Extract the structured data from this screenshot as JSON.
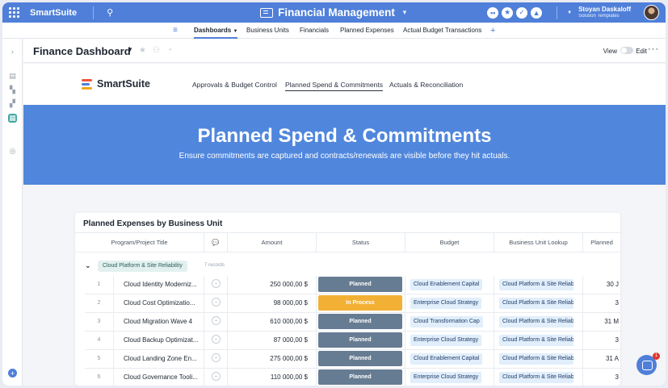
{
  "app": {
    "brand": "SmartSuite",
    "workspace_title": "Financial Management",
    "user_name": "Stoyan Daskaloff",
    "user_subtitle": "Solution Templates"
  },
  "nav_tabs": [
    {
      "label": "Dashboards",
      "active": true
    },
    {
      "label": "Business Units",
      "active": false
    },
    {
      "label": "Financials",
      "active": false
    },
    {
      "label": "Planned Expenses",
      "active": false
    },
    {
      "label": "Actual Budget Transactions",
      "active": false
    }
  ],
  "dashboard": {
    "title": "Finance Dashboard",
    "view_label": "View",
    "edit_label": "Edit"
  },
  "subnav": {
    "logo_text": "SmartSuite",
    "tabs": [
      {
        "label": "Approvals & Budget Control",
        "active": false
      },
      {
        "label": "Planned Spend & Commitments",
        "active": true
      },
      {
        "label": "Actuals & Reconciliation",
        "active": false
      }
    ]
  },
  "hero": {
    "title": "Planned Spend & Commitments",
    "subtitle": "Ensure commitments are captured and contracts/renewals are visible before they hit actuals."
  },
  "table": {
    "title": "Planned Expenses by Business Unit",
    "columns": [
      "Program/Project Title",
      "",
      "Amount",
      "Status",
      "Budget",
      "Business Unit Lookup",
      "Planned"
    ],
    "group": {
      "label": "Cloud Platform & Site Reliability",
      "count": "7 records"
    },
    "rows": [
      {
        "num": "1",
        "title": "Cloud Identity Moderniz...",
        "amount": "250 000,00 $",
        "status": "Planned",
        "budget": "Cloud Enablement Capital",
        "bu": "Cloud Platform & Site Reliabi",
        "planned": "30 J"
      },
      {
        "num": "2",
        "title": "Cloud Cost Optimizatio...",
        "amount": "98 000,00 $",
        "status": "In Process",
        "budget": "Enterprise Cloud Strategy",
        "bu": "Cloud Platform & Site Reliabi",
        "planned": "3"
      },
      {
        "num": "3",
        "title": "Cloud Migration Wave 4",
        "amount": "610 000,00 $",
        "status": "Planned",
        "budget": "Cloud Transformation Cap",
        "bu": "Cloud Platform & Site Reliabi",
        "planned": "31 M"
      },
      {
        "num": "4",
        "title": "Cloud Backup Optimizat...",
        "amount": "87 000,00 $",
        "status": "Planned",
        "budget": "Enterprise Cloud Strategy",
        "bu": "Cloud Platform & Site Reliabi",
        "planned": "3"
      },
      {
        "num": "5",
        "title": "Cloud Landing Zone En...",
        "amount": "275 000,00 $",
        "status": "Planned",
        "budget": "Cloud Enablement Capital",
        "bu": "Cloud Platform & Site Reliabi",
        "planned": "31 A"
      },
      {
        "num": "6",
        "title": "Cloud Governance Tooli...",
        "amount": "110 000,00 $",
        "status": "Planned",
        "budget": "Enterprise Cloud Strategy",
        "bu": "Cloud Platform & Site Reliabi",
        "planned": "3"
      }
    ]
  },
  "colors": {
    "topbar": "#4f7fd9",
    "hero": "#5087dd",
    "status_planned": "#667c92",
    "status_in_process": "#f2b035",
    "active_rail": "#3fa8a0"
  },
  "notifications": {
    "badge": "1"
  }
}
